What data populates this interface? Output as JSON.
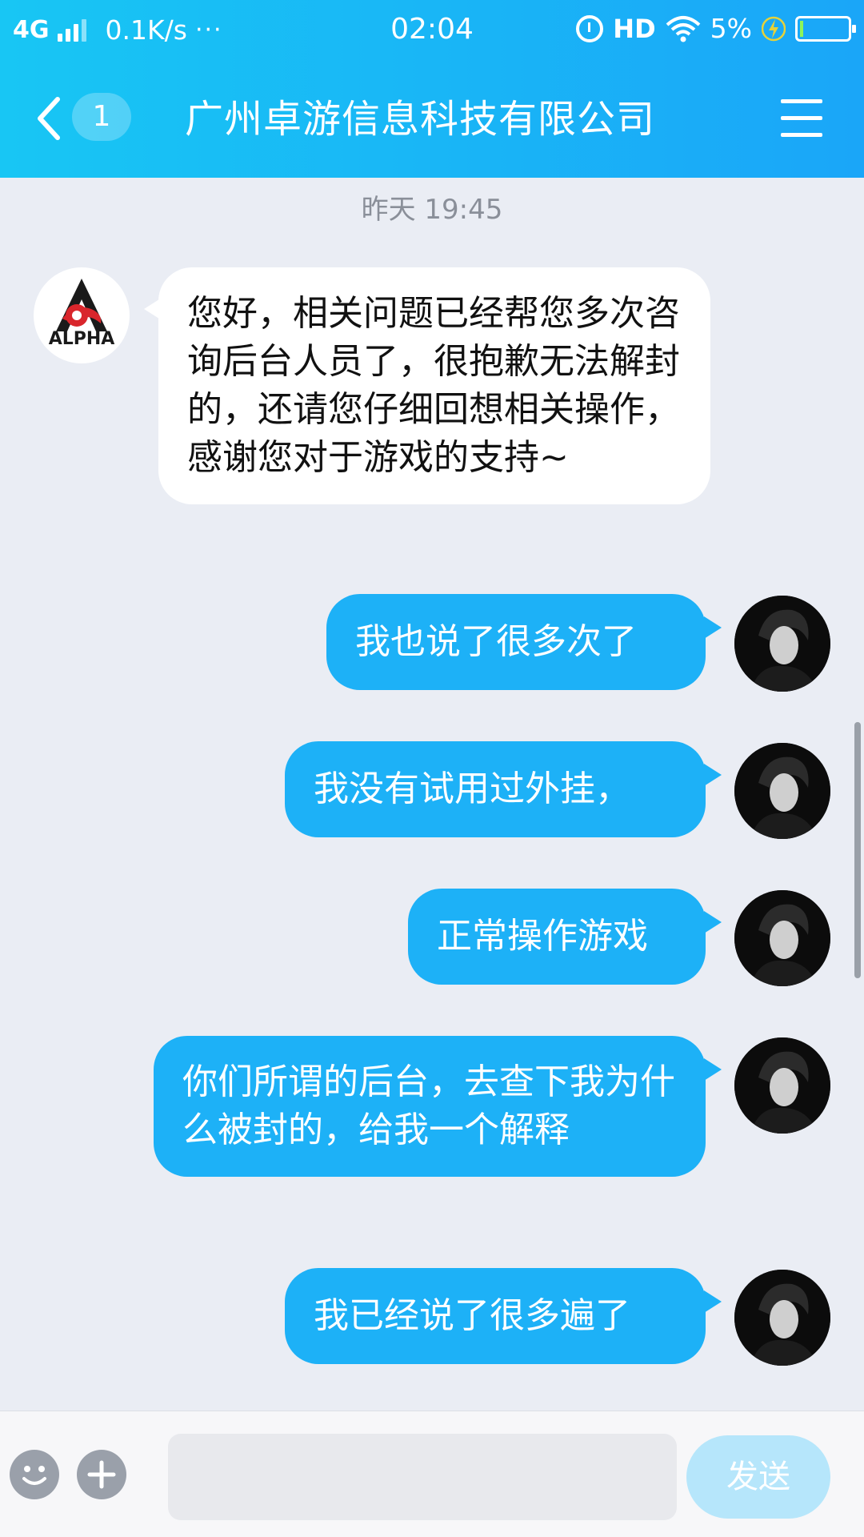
{
  "status_bar": {
    "network": "4G",
    "speed": "0.1K/s",
    "more": "···",
    "time": "02:04",
    "hd": "HD",
    "battery": "5%"
  },
  "nav": {
    "unread_count": "1",
    "title": "广州卓游信息科技有限公司"
  },
  "chat": {
    "timestamp": "昨天 19:45",
    "messages": [
      {
        "side": "in",
        "text": "您好，相关问题已经帮您多次咨询后台人员了，很抱歉无法解封的，还请您仔细回想相关操作，感谢您对于游戏的支持~"
      },
      {
        "side": "out",
        "text": "我也说了很多次了"
      },
      {
        "side": "out",
        "text": "我没有试用过外挂，"
      },
      {
        "side": "out",
        "text": "正常操作游戏"
      },
      {
        "side": "out",
        "text": "你们所谓的后台，去查下我为什么被封的，给我一个解释"
      },
      {
        "side": "out",
        "text": "我已经说了很多遍了"
      }
    ]
  },
  "company_logo_text": "ALPHA",
  "input": {
    "value": "",
    "send_label": "发送"
  },
  "colors": {
    "header_start": "#18c6f4",
    "header_end": "#1aa6f8",
    "bubble_out": "#1db1f7",
    "bubble_in": "#ffffff",
    "background": "#eaedf4",
    "send_disabled": "#b6e6fb"
  }
}
